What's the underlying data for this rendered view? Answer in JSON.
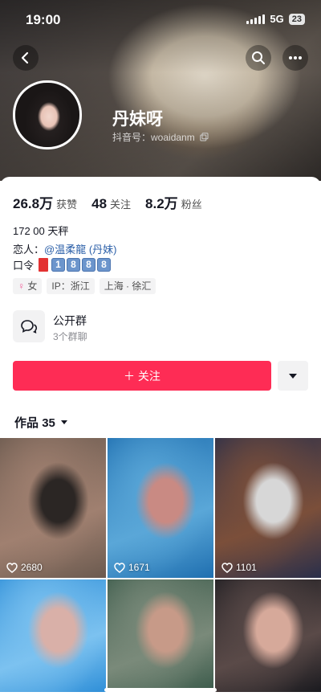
{
  "status_bar": {
    "time": "19:00",
    "network": "5G",
    "battery": "23"
  },
  "profile": {
    "name": "丹妹呀",
    "douyin_id_label": "抖音号：",
    "douyin_id": "woaidanm"
  },
  "stats": [
    {
      "value": "26.8万",
      "label": "获赞"
    },
    {
      "value": "48",
      "label": "关注"
    },
    {
      "value": "8.2万",
      "label": "粉丝"
    }
  ],
  "bio": {
    "line1": "172 00 天秤",
    "lover_label": "恋人：",
    "lover_name": "@温柔龍 (丹妹)",
    "code_label": "口令",
    "code_digits": [
      "1",
      "8",
      "8",
      "8"
    ]
  },
  "tags": {
    "gender": "女",
    "ip": "IP：浙江",
    "location": "上海 · 徐汇"
  },
  "group": {
    "title": "公开群",
    "subtitle": "3个群聊"
  },
  "follow_label": "＋ 关注",
  "works": {
    "label": "作品",
    "count": "35"
  },
  "videos": [
    {
      "likes": "2680",
      "colors": [
        "#6b5a4f",
        "#a08070",
        "#2b2624"
      ]
    },
    {
      "likes": "1671",
      "colors": [
        "#1f6fb0",
        "#5aa7d8",
        "#c98a83"
      ]
    },
    {
      "likes": "1101",
      "colors": [
        "#2a2f4a",
        "#7b4f3a",
        "#d7d7d7"
      ]
    },
    {
      "likes": "",
      "colors": [
        "#2f8fd8",
        "#7cc2f0",
        "#d9b0a8"
      ]
    },
    {
      "likes": "",
      "colors": [
        "#3a5a4a",
        "#7a8a7a",
        "#c79a88"
      ]
    },
    {
      "likes": "",
      "colors": [
        "#1a1a1f",
        "#5a4a48",
        "#d6a99a"
      ]
    }
  ]
}
